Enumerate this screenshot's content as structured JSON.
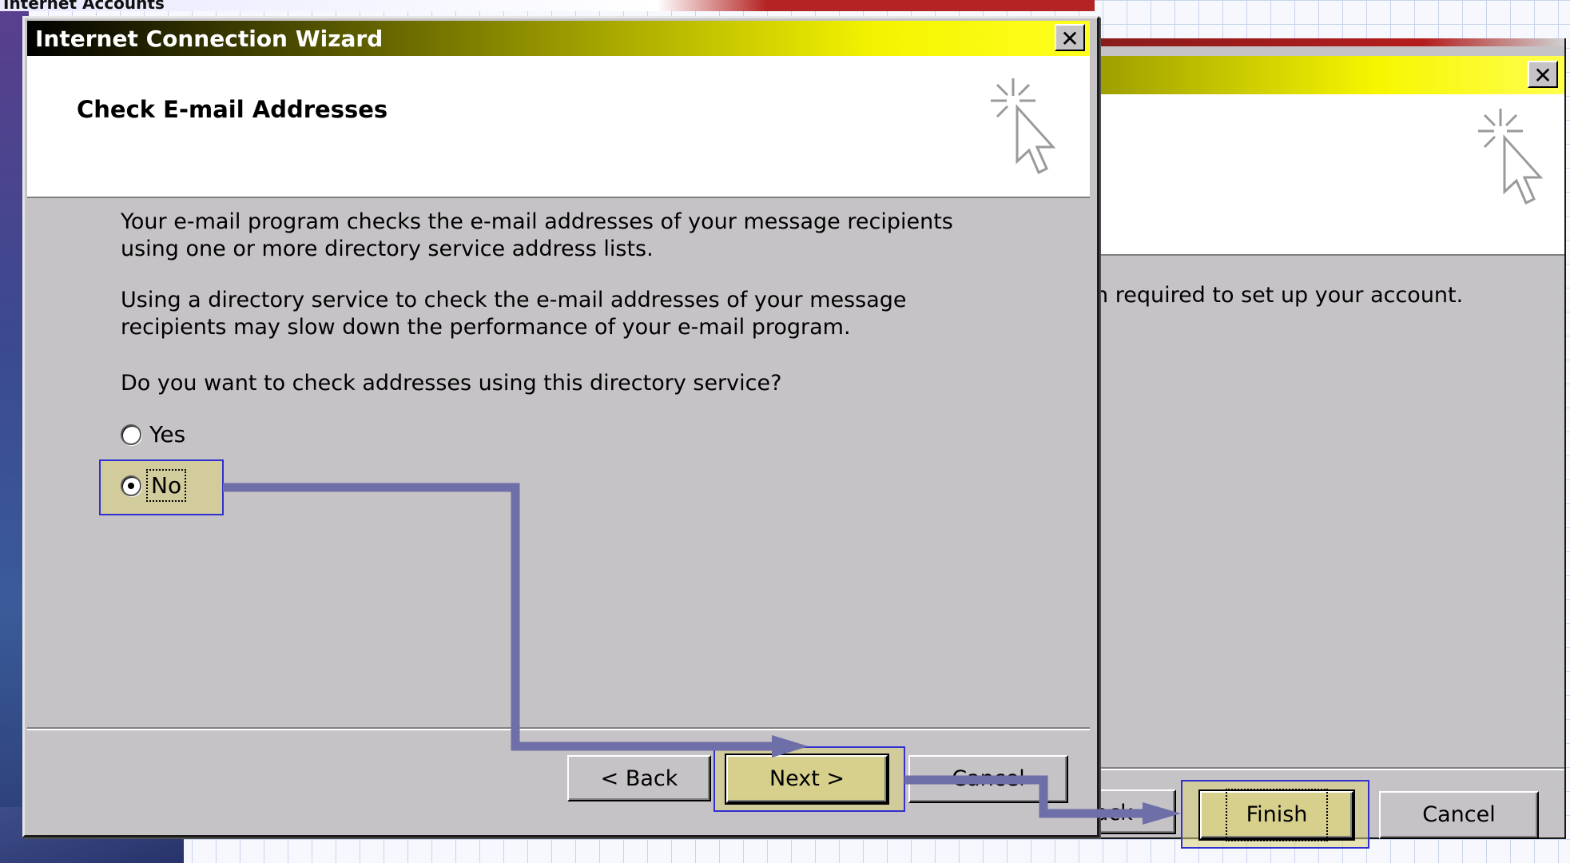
{
  "background": {
    "window_title": "Internet Accounts"
  },
  "second_dialog": {
    "text": "n required to set up your account.",
    "buttons": {
      "back": "Back",
      "finish": "Finish",
      "cancel": "Cancel"
    },
    "close_glyph": "✕"
  },
  "dialog": {
    "title": "Internet Connection Wizard",
    "close_glyph": "✕",
    "header_title": "Check E-mail Addresses",
    "paragraph1": "Your e-mail program checks the e-mail addresses of your message recipients using one or more directory service address lists.",
    "paragraph2": "Using a directory service to check the e-mail addresses of your message recipients may slow down the performance of your e-mail program.",
    "question": "Do you want to check addresses using this directory service?",
    "options": [
      {
        "label": "Yes",
        "selected": false
      },
      {
        "label": "No",
        "selected": true
      }
    ],
    "buttons": {
      "back": "< Back",
      "next": "Next >",
      "cancel": "Cancel"
    }
  },
  "colors": {
    "highlight_fill": "#d8d28a",
    "highlight_border": "#2f2fd2",
    "arrow": "#6e6ea8",
    "titlebar_end": "#f4f400"
  },
  "icons": [
    "close-icon",
    "wizard-cursor-icon",
    "flow-arrow-icon"
  ]
}
